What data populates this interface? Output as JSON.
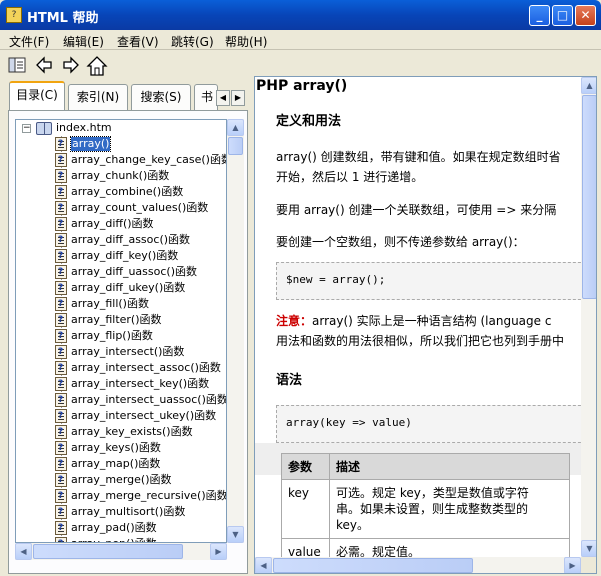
{
  "window": {
    "title": "HTML 帮助",
    "icon_text": "?",
    "buttons": {
      "minimize": "_",
      "maximize": "□",
      "close": "✕"
    }
  },
  "menu": [
    "文件(F)",
    "编辑(E)",
    "查看(V)",
    "跳转(G)",
    "帮助(H)"
  ],
  "toolbar": {
    "icons": [
      "hide-pane-icon",
      "back-arrow-icon",
      "forward-arrow-icon",
      "home-icon"
    ]
  },
  "nav": {
    "tabs": [
      "目录(C)",
      "索引(N)",
      "搜索(S)",
      "书"
    ],
    "root_label": "index.htm",
    "items": [
      "array()",
      "array_change_key_case()函数",
      "array_chunk()函数",
      "array_combine()函数",
      "array_count_values()函数",
      "array_diff()函数",
      "array_diff_assoc()函数",
      "array_diff_key()函数",
      "array_diff_uassoc()函数",
      "array_diff_ukey()函数",
      "array_fill()函数",
      "array_filter()函数",
      "array_flip()函数",
      "array_intersect()函数",
      "array_intersect_assoc()函数",
      "array_intersect_key()函数",
      "array_intersect_uassoc()函数",
      "array_intersect_ukey()函数",
      "array_key_exists()函数",
      "array_keys()函数",
      "array_map()函数",
      "array_merge()函数",
      "array_merge_recursive()函数",
      "array_multisort()函数",
      "array_pad()函数",
      "array_pop()函数"
    ],
    "selected_index": 0
  },
  "content": {
    "title": "PHP array()",
    "section1": "定义和用法",
    "p1_line1": "array() 创建数组，带有键和值。如果在规定数组时省",
    "p1_line2": "开始，然后以 1 进行递增。",
    "p2": "要用 array() 创建一个关联数组，可使用 => 来分隔",
    "p3": "要创建一个空数组，则不传递参数给 array()：",
    "code1": "$new = array();",
    "note_label": "注意：",
    "note_line1": "array() 实际上是一种语言结构 (language c",
    "note_line2": "用法和函数的用法很相似，所以我们把它也列到手册中",
    "section2": "语法",
    "code2": "array(key => value)",
    "table": {
      "headers": [
        "参数",
        "描述"
      ],
      "rows": [
        {
          "param": "key",
          "desc_line1": "可选。规定 key，类型是数值或字符",
          "desc_line2": "串。如果未设置，则生成整数类型的",
          "desc_line3": "key。"
        },
        {
          "param": "value",
          "desc_line1": "必需。规定值。",
          "desc_line2": "",
          "desc_line3": ""
        }
      ]
    }
  }
}
